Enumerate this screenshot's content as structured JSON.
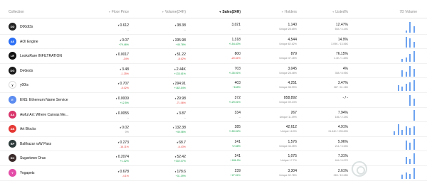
{
  "header": {
    "collection": "Collection",
    "floor": "Floor Price",
    "volume": "Volume(24H)",
    "sales": "Sales(24H)",
    "holders": "Holders",
    "listed": "Listed%",
    "vol7d": "7D Volume"
  },
  "rows": [
    {
      "name": "D00dl3s",
      "avatar_color": "#222222",
      "avatar_text": "DD",
      "floor": "0.612",
      "floor_chg": "--",
      "floor_dir": "flat",
      "vol": "38.38",
      "vol_chg": "--",
      "vol_dir": "flat",
      "sales": "3,021",
      "sales_chg": "--",
      "sales_dir": "flat",
      "holders": "1,140",
      "holders_sub": "Unique 28.65%",
      "listed": "12.47%",
      "listed_sub": "554 / 4.44K",
      "spark": [
        0,
        0,
        0,
        0,
        0,
        0,
        0,
        0,
        3,
        14,
        8
      ]
    },
    {
      "name": "AOI Engine",
      "avatar_color": "#2b6ef5",
      "avatar_text": "AE",
      "floor": "0.07",
      "floor_chg": "+79.46%",
      "floor_dir": "pos",
      "vol": "335.98",
      "vol_chg": "+45.78%",
      "vol_dir": "pos",
      "sales": "1,318",
      "sales_chg": "+154.43%",
      "sales_dir": "pos",
      "holders": "4,544",
      "holders_sub": "Unique 82.62%",
      "listed": "14.9%",
      "listed_sub": "3.09K / 13.56K",
      "spark": [
        0,
        0,
        0,
        0,
        0,
        0,
        0,
        0,
        6,
        5,
        3
      ]
    },
    {
      "name": "LooksRare INFILTRATION",
      "avatar_color": "#111111",
      "avatar_text": "LR",
      "floor": "0.0017",
      "floor_chg": "-34%",
      "floor_dir": "neg",
      "vol": "51.22",
      "vol_chg": "-8.62%",
      "vol_dir": "neg",
      "sales": "800",
      "sales_chg": "-20.31%",
      "sales_dir": "neg",
      "holders": "879",
      "holders_sub": "Unique 47.15%",
      "listed": "76.15%",
      "listed_sub": "1.4K / 1.84K",
      "spark": [
        0,
        0,
        0,
        0,
        0,
        0,
        0,
        2,
        3,
        5,
        7
      ]
    },
    {
      "name": "DeGods",
      "avatar_color": "#1a1a1a",
      "avatar_text": "DG",
      "floor": "3.48",
      "floor_chg": "-1.25%",
      "floor_dir": "neg",
      "vol": "2.44K",
      "vol_chg": "+133.61%",
      "vol_dir": "pos",
      "sales": "703",
      "sales_chg": "+135.91%",
      "sales_dir": "pos",
      "holders": "3,045",
      "holders_sub": "Unique 28.48%",
      "listed": "4%",
      "listed_sub": "358 / 8.95K",
      "spark": [
        0,
        0,
        0,
        0,
        0,
        0,
        0,
        4,
        3,
        7,
        5
      ]
    },
    {
      "name": "y00ts",
      "avatar_color": "#ffffff",
      "avatar_text": "y",
      "floor": "0.707",
      "floor_chg": "-5.02%",
      "floor_dir": "neg",
      "vol": "294.91",
      "vol_chg": "+162.54%",
      "vol_dir": "pos",
      "sales": "403",
      "sales_chg": "+165%",
      "sales_dir": "pos",
      "holders": "4,251",
      "holders_sub": "Unique 38.99%",
      "listed": "3.47%",
      "listed_sub": "387 / 11.16K",
      "spark": [
        0,
        0,
        0,
        0,
        0,
        0,
        4,
        3,
        5,
        6,
        7
      ]
    },
    {
      "name": "ENS: Ethereum Name Service",
      "avatar_color": "#5c8cf0",
      "avatar_text": "E",
      "floor": "0.0009",
      "floor_chg": "+12.5%",
      "floor_dir": "pos",
      "vol": "29.98",
      "vol_chg": "-71.06%",
      "vol_dir": "neg",
      "sales": "372",
      "sales_chg": "+129.01%",
      "sales_dir": "pos",
      "holders": "858,892",
      "holders_sub": "Unique 39.24%",
      "listed": "- / -",
      "listed_sub": "",
      "spark": [
        0,
        0,
        0,
        0,
        0,
        0,
        0,
        0,
        0,
        3,
        2
      ]
    },
    {
      "name": "Awful Art: Where Canvas Me...",
      "avatar_color": "#d9356b",
      "avatar_text": "AA",
      "floor": "0.0055",
      "floor_chg": "--",
      "floor_dir": "flat",
      "vol": "3.87",
      "vol_chg": "--",
      "vol_dir": "flat",
      "sales": "334",
      "sales_chg": "--",
      "sales_dir": "flat",
      "holders": "267",
      "holders_sub": "Unique 11.39%",
      "listed": "7.94%",
      "listed_sub": "186 / 2.34K",
      "spark": [
        0,
        0,
        0,
        0,
        0,
        0,
        0,
        0,
        0,
        0,
        10
      ]
    },
    {
      "name": "Art Blocks",
      "avatar_color": "#e53935",
      "avatar_text": "AB",
      "floor": "0.02",
      "floor_chg": "0%",
      "floor_dir": "flat",
      "vol": "132.38",
      "vol_chg": "+40.06%",
      "vol_dir": "pos",
      "sales": "285",
      "sales_chg": "+150.02%",
      "sales_dir": "pos",
      "holders": "42,612",
      "holders_sub": "Unique 18.3%",
      "listed": "4.91%",
      "listed_sub": "31.44K / 233.89K",
      "spark": [
        0,
        0,
        0,
        0,
        0,
        2,
        6,
        3,
        5,
        4,
        5
      ]
    },
    {
      "name": "Balthazar raW Pass",
      "avatar_color": "#2d3a3a",
      "avatar_text": "BP",
      "floor": "0.273",
      "floor_chg": "-16.11%",
      "floor_dir": "neg",
      "vol": "68.7",
      "vol_chg": "-6.43%",
      "vol_dir": "neg",
      "sales": "241",
      "sales_chg": "+2.58%",
      "sales_dir": "pos",
      "holders": "1,576",
      "holders_sub": "Unique 44.25%",
      "listed": "5.96%",
      "listed_sub": "211 / 3.54K",
      "spark": [
        0,
        0,
        0,
        0,
        0,
        0,
        0,
        0,
        5,
        4,
        6
      ]
    },
    {
      "name": "Sugartown Oras",
      "avatar_color": "#3b2a2a",
      "avatar_text": "SO",
      "floor": "0.2074",
      "floor_chg": "+1.32%",
      "floor_dir": "pos",
      "vol": "52.42",
      "vol_chg": "+202.07%",
      "vol_dir": "pos",
      "sales": "241",
      "sales_chg": "+186.9%",
      "sales_dir": "pos",
      "holders": "1,075",
      "holders_sub": "Unique 17.7%",
      "listed": "7.31%",
      "listed_sub": "444 / 6.07K",
      "spark": [
        0,
        0,
        0,
        0,
        0,
        0,
        0,
        0,
        4,
        3,
        6
      ]
    },
    {
      "name": "Yogapetz",
      "avatar_color": "#e34da8",
      "avatar_text": "Y",
      "floor": "0.678",
      "floor_chg": "-4.1%",
      "floor_dir": "neg",
      "vol": "178.6",
      "vol_chg": "+31.39%",
      "vol_dir": "pos",
      "sales": "239",
      "sales_chg": "+27.01%",
      "sales_dir": "pos",
      "holders": "3,304",
      "holders_sub": "Unique 32.78%",
      "listed": "2.61%",
      "listed_sub": "263 / 10.08K",
      "spark": [
        0,
        0,
        0,
        0,
        0,
        0,
        0,
        3,
        5,
        4,
        8
      ]
    }
  ],
  "colors": {
    "positive": "#16a34a",
    "negative": "#e53935",
    "spark": "#6ea3f0"
  }
}
